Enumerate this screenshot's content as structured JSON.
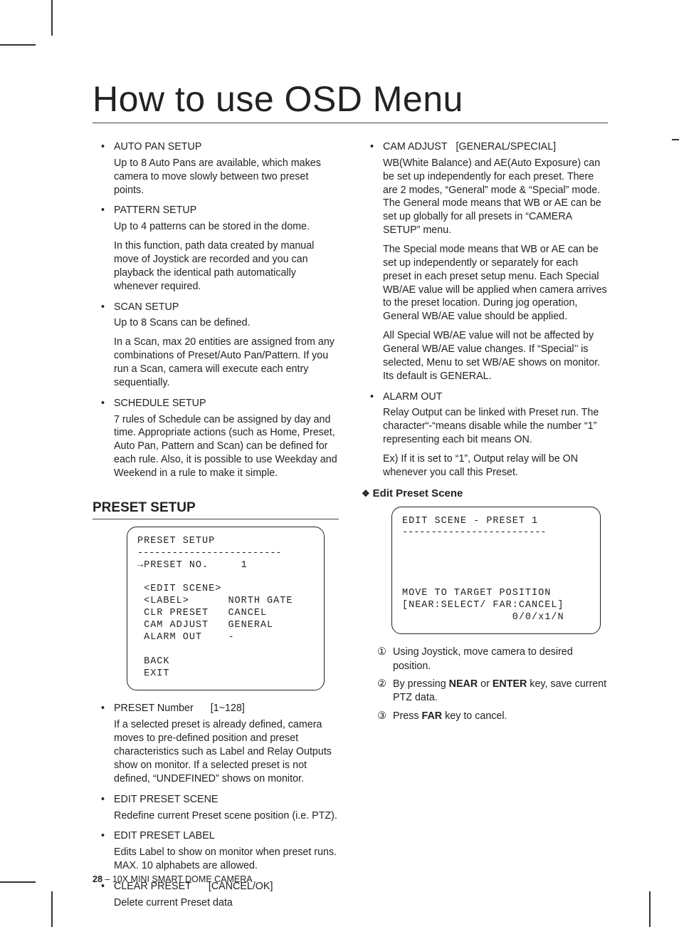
{
  "title": "How to use OSD Menu",
  "left": {
    "items": [
      {
        "head": "AUTO PAN SETUP",
        "paras": [
          "Up to 8 Auto Pans are available, which makes camera to move slowly between two preset points."
        ]
      },
      {
        "head": "PATTERN SETUP",
        "paras": [
          "Up to 4 patterns can be stored in the dome.",
          "In this function, path data created by manual move of Joystick are recorded and you can playback the identical path automatically whenever required."
        ]
      },
      {
        "head": "SCAN SETUP",
        "paras": [
          "Up to 8 Scans can be defined.",
          "In a Scan, max 20 entities are assigned from any combinations of Preset/Auto Pan/Pattern. If you run a Scan, camera will execute each entry sequentially."
        ]
      },
      {
        "head": "SCHEDULE SETUP",
        "paras": [
          "7 rules of Schedule can be assigned by day and time. Appropriate actions (such as Home, Preset, Auto Pan, Pattern and Scan) can be defined for each rule. Also, it is possible to use Weekday and Weekend in a rule to make it simple."
        ]
      }
    ],
    "section_heading": "PRESET SETUP",
    "osd": {
      "title": "PRESET SETUP",
      "dash": "-------------------------",
      "l1a": "PRESET NO.",
      "l1b": "1",
      "l2": "<EDIT SCENE>",
      "l3a": "<LABEL>",
      "l3b": "NORTH GATE",
      "l4a": "CLR PRESET",
      "l4b": "CANCEL",
      "l5a": "CAM ADJUST",
      "l5b": "GENERAL",
      "l6a": "ALARM OUT",
      "l6b": "-",
      "l7": "BACK",
      "l8": "EXIT"
    },
    "items2": [
      {
        "head": "PRESET Number",
        "opt": "[1~128]",
        "paras": [
          "If a selected preset is already defined, camera moves to pre-defined position and preset characteristics such as Label and Relay Outputs show on monitor. If a selected preset is not defined, “UNDEFINED” shows on monitor."
        ]
      },
      {
        "head": "EDIT PRESET SCENE",
        "paras": [
          "Redefine current Preset scene position (i.e. PTZ)."
        ]
      },
      {
        "head": "EDIT PRESET LABEL",
        "paras": [
          "Edits Label to show on monitor when preset runs. MAX. 10 alphabets are allowed."
        ]
      },
      {
        "head": "CLEAR PRESET",
        "opt": "[CANCEL/OK]",
        "paras": [
          "Delete current Preset data"
        ]
      }
    ]
  },
  "right": {
    "items": [
      {
        "head": "CAM ADJUST",
        "opt": "[GENERAL/SPECIAL]",
        "paras": [
          "WB(White Balance) and AE(Auto Exposure) can be set up independently for each preset. There are 2 modes, “General” mode & “Special” mode. The General mode means that WB or AE can be set up globally for all presets in “CAMERA SETUP” menu.",
          "The Special mode means that WB or AE can be set up independently or separately for each preset in each preset setup menu. Each Special WB/AE value will be applied when camera arrives to the preset location. During jog operation, General WB/AE value should be applied.",
          "All Special WB/AE value will not be affected by General WB/AE value changes. If “Special’’ is selected, Menu to set WB/AE shows on monitor. Its default is GENERAL."
        ]
      },
      {
        "head": "ALARM OUT",
        "paras": [
          "Relay Output can be linked with Preset run. The character“-“means disable while the number “1” representing each bit means ON.",
          "Ex) If it is set to “1”, Output relay will be ON whenever you call this Preset."
        ]
      }
    ],
    "sub_heading": "Edit Preset Scene",
    "osd": {
      "title": "EDIT SCENE - PRESET 1",
      "dash": "-------------------------",
      "l1": "MOVE TO TARGET POSITION",
      "l2": "[NEAR:SELECT/ FAR:CANCEL]",
      "l3": "0/0/x1/N"
    },
    "steps": [
      {
        "pre": "Using Joystick, move camera to desired position."
      },
      {
        "pre": "By pressing ",
        "bold": "NEAR",
        "mid": " or ",
        "bold2": "ENTER",
        "post": " key, save current PTZ data."
      },
      {
        "pre": "Press ",
        "bold": "FAR",
        "post": " key to cancel."
      }
    ]
  },
  "footer": {
    "page": "28",
    "sep": " – ",
    "title": "10X MINI SMART DOME CAMERA"
  }
}
